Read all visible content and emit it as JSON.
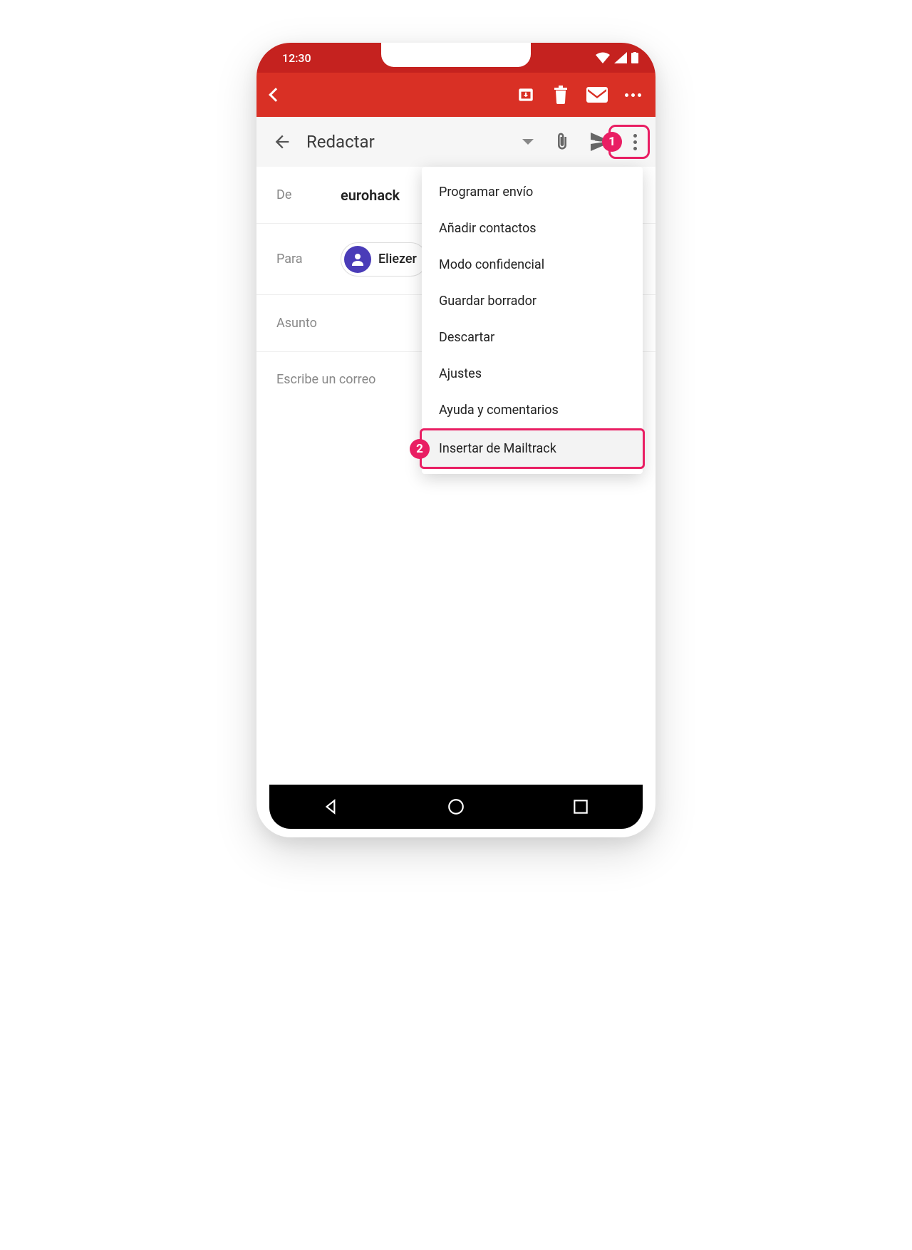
{
  "status": {
    "time": "12:30"
  },
  "compose": {
    "title": "Redactar",
    "from_label": "De",
    "from_value": "eurohack",
    "to_label": "Para",
    "to_chip": "Eliezer",
    "subject_label": "Asunto",
    "body_placeholder": "Escribe un correo"
  },
  "menu": {
    "items": [
      "Programar envío",
      "Añadir contactos",
      "Modo confidencial",
      "Guardar borrador",
      "Descartar",
      "Ajustes",
      "Ayuda y comentarios",
      "Insertar de Mailtrack"
    ]
  },
  "callouts": {
    "one": "1",
    "two": "2"
  }
}
